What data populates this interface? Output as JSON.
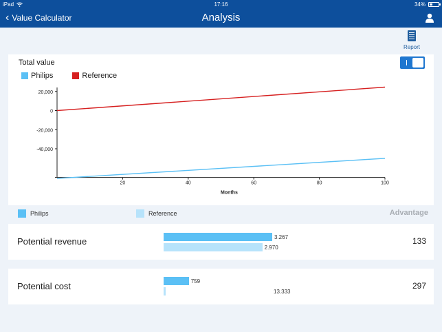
{
  "status": {
    "device": "iPad",
    "time": "17:16",
    "battery": "34%",
    "battery_level": 0.34
  },
  "nav": {
    "back_label": "Value Calculator",
    "title": "Analysis"
  },
  "report": {
    "label": "Report"
  },
  "colors": {
    "philips": "#5bc0f5",
    "reference": "#d62020",
    "reference_bar": "#b7e3fb",
    "nav": "#0d4f9c"
  },
  "chart": {
    "title": "Total value",
    "legend": [
      {
        "name": "Philips",
        "color": "#5bc0f5"
      },
      {
        "name": "Reference",
        "color": "#d62020"
      }
    ]
  },
  "chart_data": {
    "type": "line",
    "title": "Total value",
    "xlabel": "Months",
    "ylabel": "",
    "xlim": [
      0,
      100
    ],
    "ylim": [
      -70000,
      25000
    ],
    "xticks": [
      "20",
      "40",
      "60",
      "80",
      "100"
    ],
    "yticks": [
      "20,000",
      "0",
      "-20,000",
      "-40,000"
    ],
    "ytick_values": [
      20000,
      0,
      -20000,
      -40000
    ],
    "xtick_values": [
      20,
      40,
      60,
      80,
      100
    ],
    "series": [
      {
        "name": "Philips",
        "x": [
          0,
          100
        ],
        "y": [
          -71000,
          -50000
        ],
        "color": "#5bc0f5"
      },
      {
        "name": "Reference",
        "x": [
          0,
          100
        ],
        "y": [
          0,
          24500
        ],
        "color": "#d62020"
      }
    ]
  },
  "bars_legend": {
    "philips": "Philips",
    "reference": "Reference",
    "advantage": "Advantage"
  },
  "rows": [
    {
      "label": "Potential revenue",
      "philips_value": 3267,
      "philips_label": "3.267",
      "reference_value": 2970,
      "reference_label": "2.970",
      "advantage": "133"
    },
    {
      "label": "Potential cost",
      "philips_value": 759,
      "philips_label": "759",
      "reference_value": 13333,
      "reference_label": "13.333",
      "advantage": "297"
    }
  ]
}
